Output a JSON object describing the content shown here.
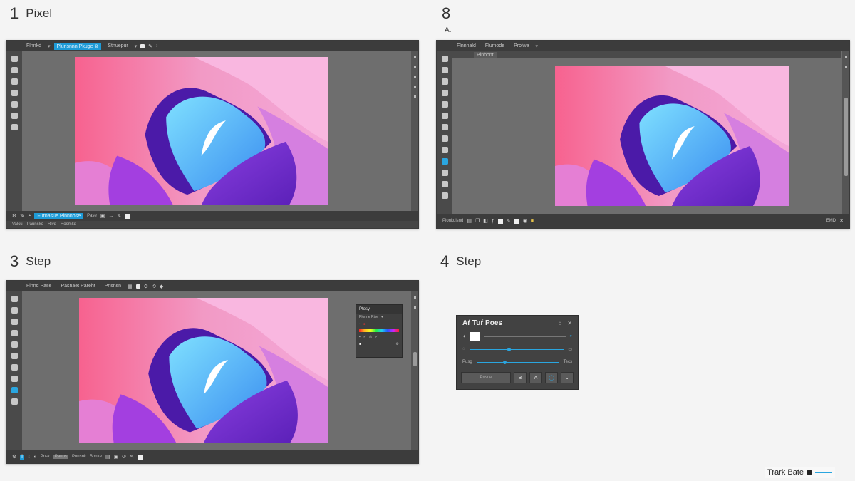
{
  "steps": {
    "s1": {
      "number": "1",
      "label": "Pixel"
    },
    "s2": {
      "number": "8",
      "label": "",
      "subnote": "A."
    },
    "s3": {
      "number": "3",
      "label": "Step"
    },
    "s4": {
      "number": "4",
      "label": "Step"
    }
  },
  "panel1": {
    "menu": [
      {
        "label": "Flnnkd",
        "active": false
      },
      {
        "label": "Plunsnnn Pkuge ⊗",
        "active": true
      },
      {
        "label": "Stnuepur",
        "active": false
      }
    ],
    "bottom_active": "Furnasue Plnnnose",
    "bottom_text": "Pase",
    "status": [
      "Valcu",
      "Paunsko",
      "Rivd",
      "Rosmkd"
    ]
  },
  "panel2": {
    "menu": [
      {
        "label": "Flnnnald",
        "active": false
      },
      {
        "label": "Flumode",
        "active": false
      },
      {
        "label": "Prolwe",
        "active": false
      }
    ],
    "sub_tab": "Pinbont",
    "status_left": "Plonkdisnd",
    "status_right": "EMD"
  },
  "panel3": {
    "menu": [
      {
        "label": "Flnnd Pase",
        "active": false
      },
      {
        "label": "Pasnaet Pareht",
        "active": false
      },
      {
        "label": "Pnsnsn",
        "active": false
      }
    ],
    "bottom_items": [
      "Pnsk",
      "Pauns",
      "Pnnsnk",
      "Bonke"
    ],
    "float_panel": {
      "title": "Ptosy",
      "row1": "Plonne Rise"
    }
  },
  "props": {
    "title": "Aŕ Tuŕ Poes",
    "row3_left": "Pusg",
    "row3_right": "Tecs",
    "field": "Pnsne"
  },
  "footer": {
    "badge": "Trark Bate"
  },
  "colors": {
    "accent": "#1e9bd7",
    "chrome_dark": "#3c3c3c",
    "workspace": "#6e6e6e"
  }
}
